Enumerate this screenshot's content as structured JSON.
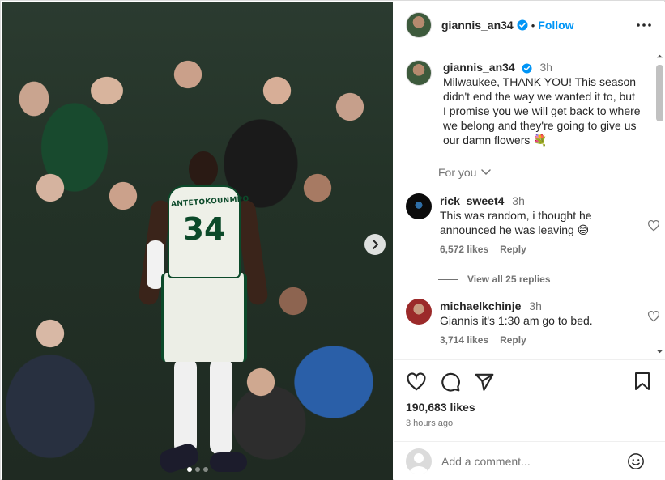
{
  "post": {
    "jersey_name": "ANTETOKOUNMPO",
    "jersey_number": "34",
    "carousel_count": 3,
    "carousel_active": 0
  },
  "header": {
    "username": "giannis_an34",
    "separator": "•",
    "follow_label": "Follow"
  },
  "caption": {
    "username": "giannis_an34",
    "time": "3h",
    "text": "Milwaukee, THANK YOU! This season didn't end the way we wanted it to, but I promise you we will get back to where we belong and they're going to give us our damn flowers 💐"
  },
  "for_you_label": "For you",
  "comments": [
    {
      "username": "rick_sweet4",
      "time": "3h",
      "text": "This was random, i thought he announced he was leaving 😅",
      "likes": "6,572 likes",
      "reply_label": "Reply"
    },
    {
      "username": "michaelkchinje",
      "time": "3h",
      "text": "Giannis it's 1:30 am go to bed.",
      "likes": "3,714 likes",
      "reply_label": "Reply"
    }
  ],
  "view_replies_label": "View all 25 replies",
  "likes_count": "190,683 likes",
  "post_time": "3 hours ago",
  "add_comment": {
    "placeholder": "Add a comment..."
  },
  "colors": {
    "link_blue": "#0095f6",
    "verified_blue": "#0095f6",
    "muted_text": "#737373",
    "primary_text": "#262626",
    "divider": "#efefef"
  },
  "icons": {
    "verified": "verified-badge-icon",
    "more": "more-horizontal-icon",
    "heart": "heart-icon",
    "comment": "comment-bubble-icon",
    "share": "paper-plane-icon",
    "bookmark": "bookmark-icon",
    "emoji": "emoji-smile-icon",
    "next": "chevron-right-icon",
    "chevron_down": "chevron-down-icon"
  }
}
